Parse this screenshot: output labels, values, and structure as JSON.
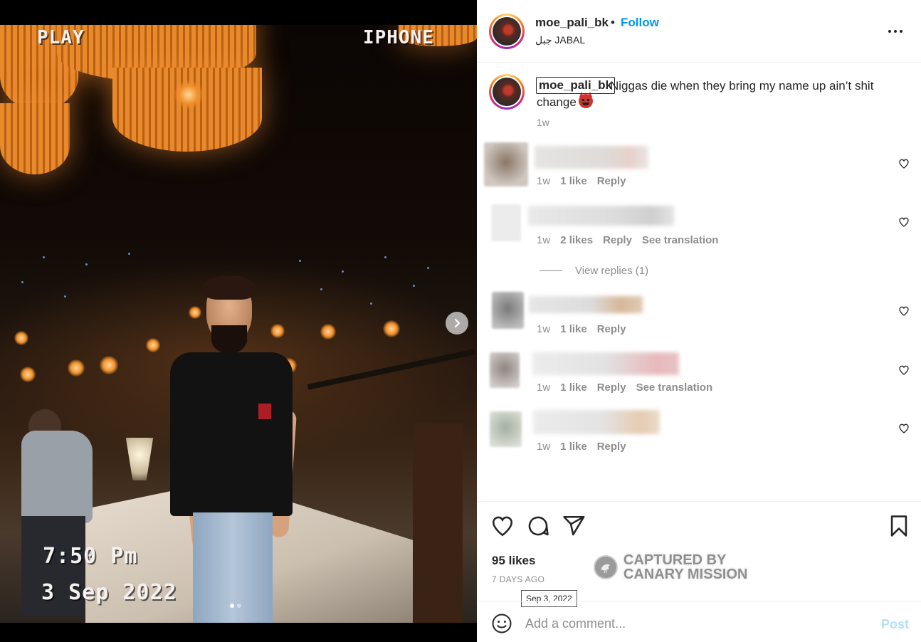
{
  "media": {
    "overlay_top_left": "PLAY",
    "overlay_top_right": "IPHONE",
    "overlay_time": "7:50 Pm",
    "overlay_date": "3 Sep 2022",
    "carousel_total": 2,
    "carousel_active": 1
  },
  "header": {
    "username": "moe_pali_bk",
    "separator": "•",
    "follow_label": "Follow",
    "location": "جبل JABAL",
    "more_icon": "more-horizontal-icon"
  },
  "caption": {
    "username": "moe_pali_bk",
    "text": "Niggas die when they bring my name up ain’t shit change",
    "emoji": "smiling-devil-emoji",
    "time": "1w"
  },
  "comments": [
    {
      "time": "1w",
      "likes": "1 like",
      "reply": "Reply"
    },
    {
      "time": "1w",
      "likes": "2 likes",
      "reply": "Reply",
      "translation": "See translation"
    },
    {
      "time": "1w",
      "likes": "1 like",
      "reply": "Reply"
    },
    {
      "time": "1w",
      "likes": "1 like",
      "reply": "Reply",
      "translation": "See translation"
    },
    {
      "time": "1w",
      "likes": "1 like",
      "reply": "Reply"
    }
  ],
  "view_replies": "View replies (1)",
  "actions": {
    "likes": "95 likes",
    "posted_ago": "7 DAYS AGO",
    "tooltip_date": "Sep 3, 2022"
  },
  "watermark": {
    "line1": "CAPTURED BY",
    "line2": "CANARY MISSION"
  },
  "comment_box": {
    "placeholder": "Add a comment...",
    "post_label": "Post"
  },
  "colors": {
    "accent": "#0095f6",
    "post_disabled": "#b2dffc",
    "muted": "#8e8e8e",
    "text": "#262626"
  }
}
